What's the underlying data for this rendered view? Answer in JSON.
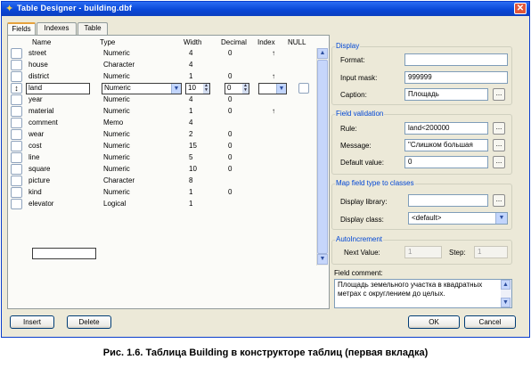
{
  "window": {
    "title": "Table Designer - building.dbf",
    "close_glyph": "✕",
    "accent_color": "#0a48d8"
  },
  "tabs": [
    {
      "label": "Fields"
    },
    {
      "label": "Indexes"
    },
    {
      "label": "Table"
    }
  ],
  "grid": {
    "columns": {
      "name": "Name",
      "type": "Type",
      "width": "Width",
      "decimal": "Decimal",
      "index": "Index",
      "null": "NULL"
    },
    "rows": [
      {
        "name": "street",
        "type": "Numeric",
        "width": "4",
        "decimal": "0",
        "index": "↑"
      },
      {
        "name": "house",
        "type": "Character",
        "width": "4",
        "decimal": "",
        "index": ""
      },
      {
        "name": "district",
        "type": "Numeric",
        "width": "1",
        "decimal": "0",
        "index": "↑"
      },
      {
        "name": "land",
        "type": "Numeric",
        "width": "10",
        "decimal": "0",
        "index": ""
      },
      {
        "name": "year",
        "type": "Numeric",
        "width": "4",
        "decimal": "0",
        "index": ""
      },
      {
        "name": "material",
        "type": "Numeric",
        "width": "1",
        "decimal": "0",
        "index": "↑"
      },
      {
        "name": "comment",
        "type": "Memo",
        "width": "4",
        "decimal": "",
        "index": ""
      },
      {
        "name": "wear",
        "type": "Numeric",
        "width": "2",
        "decimal": "0",
        "index": ""
      },
      {
        "name": "cost",
        "type": "Numeric",
        "width": "15",
        "decimal": "0",
        "index": ""
      },
      {
        "name": "line",
        "type": "Numeric",
        "width": "5",
        "decimal": "0",
        "index": ""
      },
      {
        "name": "square",
        "type": "Numeric",
        "width": "10",
        "decimal": "0",
        "index": ""
      },
      {
        "name": "picture",
        "type": "Character",
        "width": "8",
        "decimal": "",
        "index": ""
      },
      {
        "name": "kind",
        "type": "Numeric",
        "width": "1",
        "decimal": "0",
        "index": ""
      },
      {
        "name": "elevator",
        "type": "Logical",
        "width": "1",
        "decimal": "",
        "index": ""
      }
    ],
    "current_row_marker": "↕"
  },
  "display": {
    "title": "Display",
    "format_label": "Format:",
    "format_value": "",
    "input_mask_label": "Input mask:",
    "input_mask_value": "999999",
    "caption_label": "Caption:",
    "caption_value": "Площадь"
  },
  "validation": {
    "title": "Field validation",
    "rule_label": "Rule:",
    "rule_value": "land<200000",
    "message_label": "Message:",
    "message_value": "\"Слишком большая",
    "default_label": "Default value:",
    "default_value": "0"
  },
  "map_classes": {
    "title": "Map field type to classes",
    "library_label": "Display library:",
    "library_value": "",
    "class_label": "Display class:",
    "class_value": "<default>"
  },
  "autoincrement": {
    "title": "AutoIncrement",
    "next_label": "Next Value:",
    "next_value": "1",
    "step_label": "Step:",
    "step_value": "1"
  },
  "comment": {
    "label": "Field comment:",
    "text": "Площадь земельного участка в квадратных метрах с округлением до целых."
  },
  "buttons": {
    "insert": "Insert",
    "delete": "Delete",
    "ok": "OK",
    "cancel": "Cancel",
    "ellipsis": "..."
  },
  "figure_caption": "Рис. 1.6. Таблица Building в конструкторе таблиц (первая вкладка)"
}
